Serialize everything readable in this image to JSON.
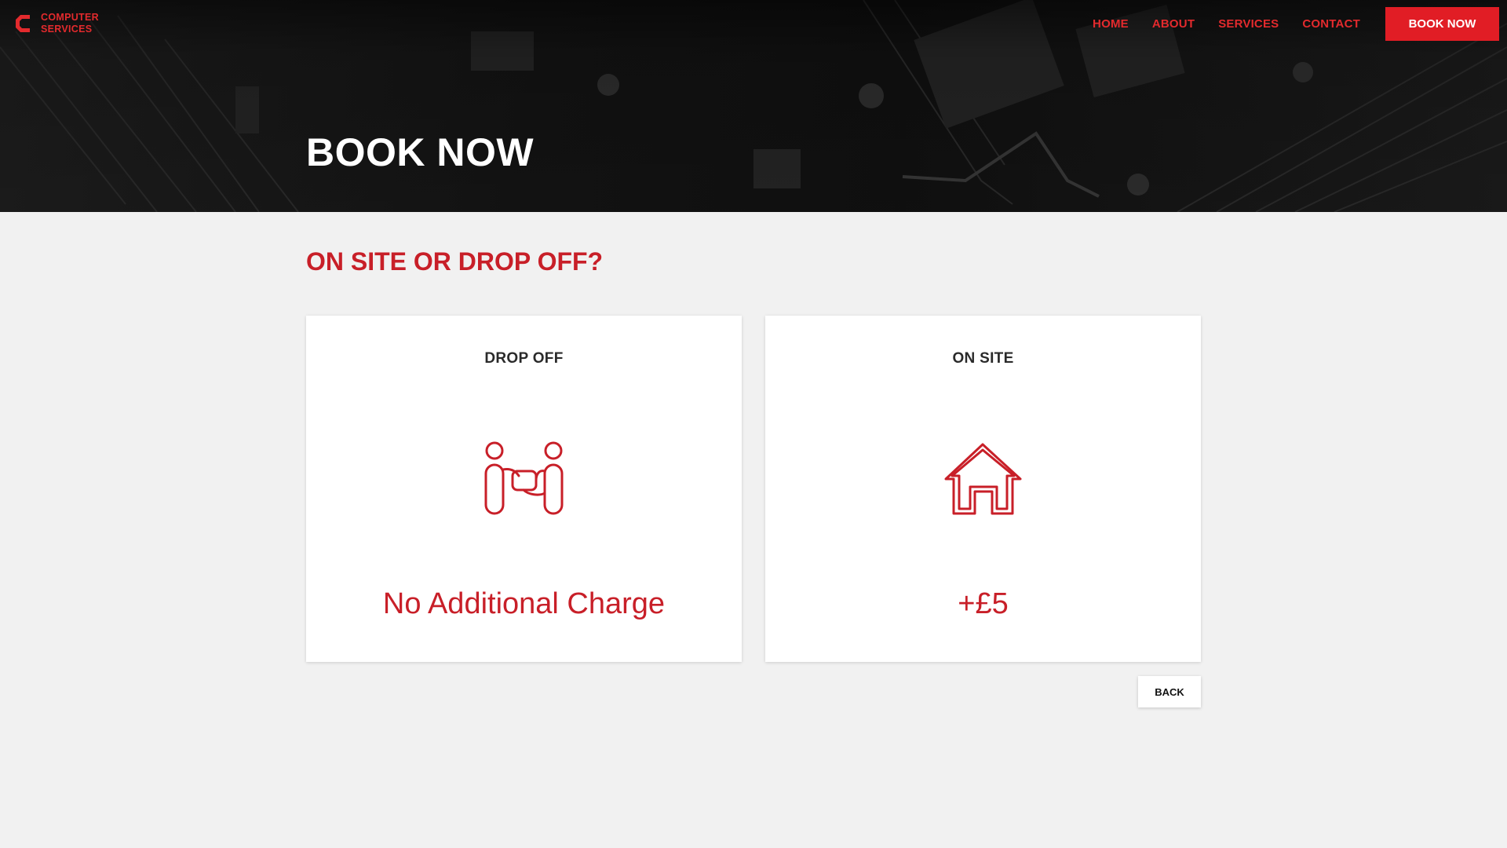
{
  "brand": {
    "logo_line1": "COMPUTER",
    "logo_line2": "SERVICES",
    "accent_color": "#e11d25",
    "heading_color": "#c81f28"
  },
  "nav": {
    "items": [
      {
        "label": "HOME"
      },
      {
        "label": "ABOUT"
      },
      {
        "label": "SERVICES"
      },
      {
        "label": "CONTACT"
      }
    ],
    "cta_label": "BOOK NOW"
  },
  "hero": {
    "title": "BOOK NOW"
  },
  "main": {
    "question": "ON SITE OR DROP OFF?",
    "options": [
      {
        "title": "DROP OFF",
        "icon": "handover-icon",
        "price": "No Additional Charge"
      },
      {
        "title": "ON SITE",
        "icon": "house-icon",
        "price": "+£5"
      }
    ],
    "back_label": "BACK"
  }
}
